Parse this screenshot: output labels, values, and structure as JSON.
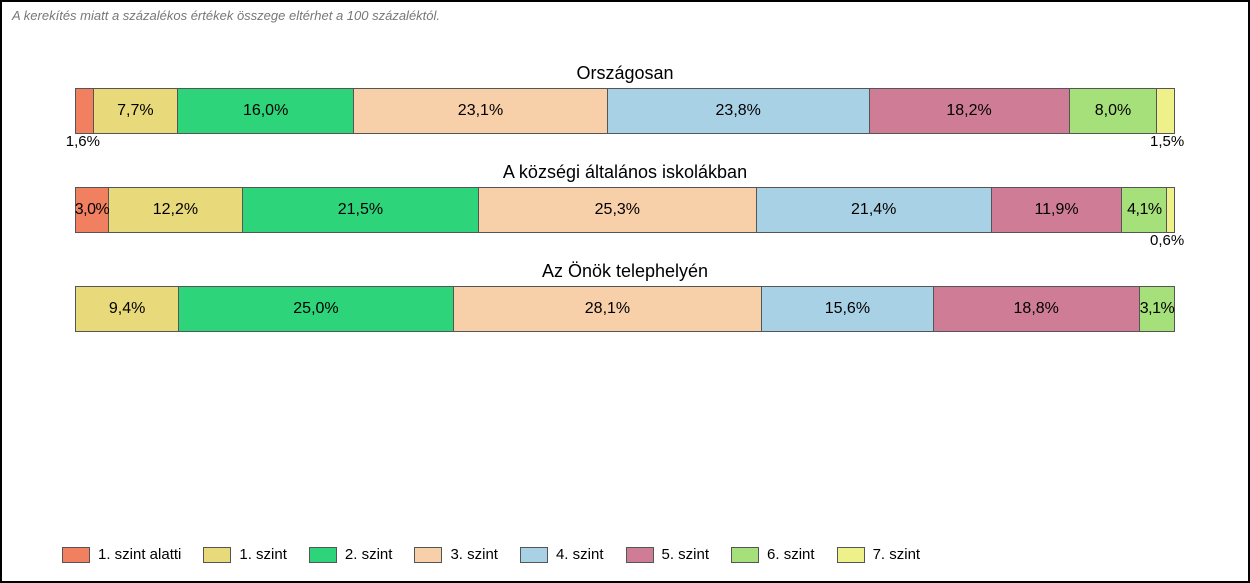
{
  "note": "A kerekítés miatt a százalékos értékek összege eltérhet a 100 százaléktól.",
  "levels": [
    {
      "key": "l0",
      "label": "1. szint alatti",
      "color": "#f08060"
    },
    {
      "key": "l1",
      "label": "1. szint",
      "color": "#e8d97a"
    },
    {
      "key": "l2",
      "label": "2. szint",
      "color": "#2ed47a"
    },
    {
      "key": "l3",
      "label": "3. szint",
      "color": "#f7cfa8"
    },
    {
      "key": "l4",
      "label": "4. szint",
      "color": "#a9d1e5"
    },
    {
      "key": "l5",
      "label": "5. szint",
      "color": "#cf7d96"
    },
    {
      "key": "l6",
      "label": "6. szint",
      "color": "#a6e07a"
    },
    {
      "key": "l7",
      "label": "7. szint",
      "color": "#eef08a"
    }
  ],
  "chart_data": {
    "type": "bar",
    "stacked": true,
    "orientation": "horizontal",
    "unit": "%",
    "categories": [
      "Országosan",
      "A községi általános iskolákban",
      "Az Önök telephelyén"
    ],
    "series": [
      {
        "name": "1. szint alatti",
        "values": [
          1.6,
          3.0,
          0.0
        ]
      },
      {
        "name": "1. szint",
        "values": [
          7.7,
          12.2,
          9.4
        ]
      },
      {
        "name": "2. szint",
        "values": [
          16.0,
          21.5,
          25.0
        ]
      },
      {
        "name": "3. szint",
        "values": [
          23.1,
          25.3,
          28.1
        ]
      },
      {
        "name": "4. szint",
        "values": [
          23.8,
          21.4,
          15.6
        ]
      },
      {
        "name": "5. szint",
        "values": [
          18.2,
          11.9,
          18.8
        ]
      },
      {
        "name": "6. szint",
        "values": [
          8.0,
          4.1,
          3.1
        ]
      },
      {
        "name": "7. szint",
        "values": [
          1.5,
          0.6,
          0.0
        ]
      }
    ]
  },
  "display": {
    "groups": [
      {
        "title": "Országosan",
        "segments": [
          {
            "level": 0,
            "text": "1,6%",
            "pos": "below-left"
          },
          {
            "level": 1,
            "text": "7,7%",
            "pos": "in"
          },
          {
            "level": 2,
            "text": "16,0%",
            "pos": "in"
          },
          {
            "level": 3,
            "text": "23,1%",
            "pos": "in"
          },
          {
            "level": 4,
            "text": "23,8%",
            "pos": "in"
          },
          {
            "level": 5,
            "text": "18,2%",
            "pos": "in"
          },
          {
            "level": 6,
            "text": "8,0%",
            "pos": "in"
          },
          {
            "level": 7,
            "text": "1,5%",
            "pos": "below-right"
          }
        ]
      },
      {
        "title": "A községi általános iskolákban",
        "segments": [
          {
            "level": 0,
            "text": "3,0%",
            "pos": "in-tight"
          },
          {
            "level": 1,
            "text": "12,2%",
            "pos": "in"
          },
          {
            "level": 2,
            "text": "21,5%",
            "pos": "in"
          },
          {
            "level": 3,
            "text": "25,3%",
            "pos": "in"
          },
          {
            "level": 4,
            "text": "21,4%",
            "pos": "in"
          },
          {
            "level": 5,
            "text": "11,9%",
            "pos": "in"
          },
          {
            "level": 6,
            "text": "4,1%",
            "pos": "in-tight"
          },
          {
            "level": 7,
            "text": "0,6%",
            "pos": "below-right"
          }
        ]
      },
      {
        "title": "Az Önök telephelyén",
        "segments": [
          {
            "level": 1,
            "text": "9,4%",
            "pos": "in"
          },
          {
            "level": 2,
            "text": "25,0%",
            "pos": "in"
          },
          {
            "level": 3,
            "text": "28,1%",
            "pos": "in"
          },
          {
            "level": 4,
            "text": "15,6%",
            "pos": "in"
          },
          {
            "level": 5,
            "text": "18,8%",
            "pos": "in"
          },
          {
            "level": 6,
            "text": "3,1%",
            "pos": "in-tight"
          }
        ]
      }
    ]
  }
}
